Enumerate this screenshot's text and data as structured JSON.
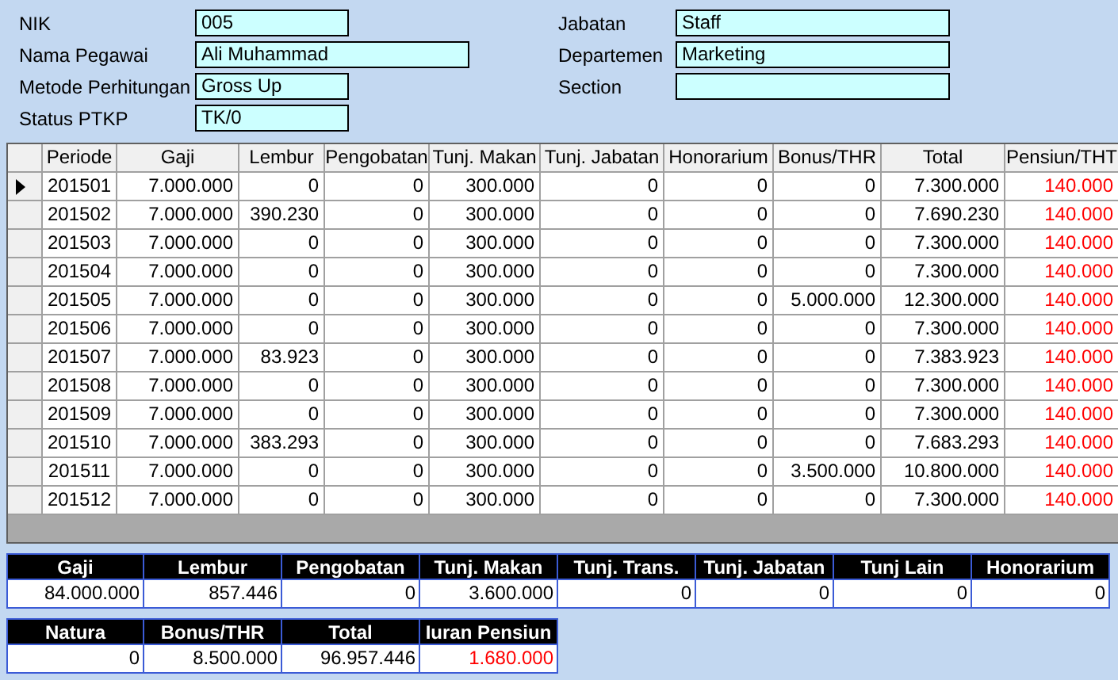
{
  "employee": {
    "left": [
      {
        "label": "NIK",
        "value": "005"
      },
      {
        "label": "Nama Pegawai",
        "value": "Ali Muhammad"
      },
      {
        "label": "Metode Perhitungan",
        "value": "Gross Up"
      },
      {
        "label": "Status PTKP",
        "value": "TK/0"
      }
    ],
    "right": [
      {
        "label": "Jabatan",
        "value": "Staff"
      },
      {
        "label": "Departemen",
        "value": "Marketing"
      },
      {
        "label": "Section"
      }
    ]
  },
  "grid": {
    "columns": [
      {
        "label": "Periode",
        "kind": "text"
      },
      {
        "label": "Gaji",
        "kind": "amount"
      },
      {
        "label": "Lembur",
        "kind": "amount"
      },
      {
        "label": "Pengobatan",
        "kind": "amount"
      },
      {
        "label": "Tunj. Makan",
        "kind": "amount"
      },
      {
        "label": "Tunj. Jabatan",
        "kind": "amount"
      },
      {
        "label": "Honorarium",
        "kind": "amount"
      },
      {
        "label": "Bonus/THR",
        "kind": "amount"
      },
      {
        "label": "Total",
        "kind": "amount"
      },
      {
        "label": "Pensiun/THT",
        "kind": "deduction"
      }
    ],
    "rows": [
      {
        "selected": true,
        "cells": [
          "201501",
          "7.000.000",
          "0",
          "0",
          "300.000",
          "0",
          "0",
          "0",
          "7.300.000",
          "140.000"
        ]
      },
      {
        "selected": false,
        "cells": [
          "201502",
          "7.000.000",
          "390.230",
          "0",
          "300.000",
          "0",
          "0",
          "0",
          "7.690.230",
          "140.000"
        ]
      },
      {
        "selected": false,
        "cells": [
          "201503",
          "7.000.000",
          "0",
          "0",
          "300.000",
          "0",
          "0",
          "0",
          "7.300.000",
          "140.000"
        ]
      },
      {
        "selected": false,
        "cells": [
          "201504",
          "7.000.000",
          "0",
          "0",
          "300.000",
          "0",
          "0",
          "0",
          "7.300.000",
          "140.000"
        ]
      },
      {
        "selected": false,
        "cells": [
          "201505",
          "7.000.000",
          "0",
          "0",
          "300.000",
          "0",
          "0",
          "5.000.000",
          "12.300.000",
          "140.000"
        ]
      },
      {
        "selected": false,
        "cells": [
          "201506",
          "7.000.000",
          "0",
          "0",
          "300.000",
          "0",
          "0",
          "0",
          "7.300.000",
          "140.000"
        ]
      },
      {
        "selected": false,
        "cells": [
          "201507",
          "7.000.000",
          "83.923",
          "0",
          "300.000",
          "0",
          "0",
          "0",
          "7.383.923",
          "140.000"
        ]
      },
      {
        "selected": false,
        "cells": [
          "201508",
          "7.000.000",
          "0",
          "0",
          "300.000",
          "0",
          "0",
          "0",
          "7.300.000",
          "140.000"
        ]
      },
      {
        "selected": false,
        "cells": [
          "201509",
          "7.000.000",
          "0",
          "0",
          "300.000",
          "0",
          "0",
          "0",
          "7.300.000",
          "140.000"
        ]
      },
      {
        "selected": false,
        "cells": [
          "201510",
          "7.000.000",
          "383.293",
          "0",
          "300.000",
          "0",
          "0",
          "0",
          "7.683.293",
          "140.000"
        ]
      },
      {
        "selected": false,
        "cells": [
          "201511",
          "7.000.000",
          "0",
          "0",
          "300.000",
          "0",
          "0",
          "3.500.000",
          "10.800.000",
          "140.000"
        ]
      },
      {
        "selected": false,
        "cells": [
          "201512",
          "7.000.000",
          "0",
          "0",
          "300.000",
          "0",
          "0",
          "0",
          "7.300.000",
          "140.000"
        ]
      }
    ]
  },
  "summary": [
    [
      {
        "label": "Gaji",
        "value": "84.000.000",
        "kind": "amount"
      },
      {
        "label": "Lembur",
        "value": "857.446",
        "kind": "amount"
      },
      {
        "label": "Pengobatan",
        "value": "0",
        "kind": "amount"
      },
      {
        "label": "Tunj. Makan",
        "value": "3.600.000",
        "kind": "amount"
      },
      {
        "label": "Tunj. Trans.",
        "value": "0",
        "kind": "amount"
      },
      {
        "label": "Tunj. Jabatan",
        "value": "0",
        "kind": "amount"
      },
      {
        "label": "Tunj Lain",
        "value": "0",
        "kind": "amount"
      },
      {
        "label": "Honorarium",
        "value": "0",
        "kind": "amount"
      }
    ],
    [
      {
        "label": "Natura",
        "value": "0",
        "kind": "amount"
      },
      {
        "label": "Bonus/THR",
        "value": "8.500.000",
        "kind": "amount"
      },
      {
        "label": "Total",
        "value": "96.957.446",
        "kind": "amount"
      },
      {
        "label": "Iuran Pensiun",
        "value": "1.680.000",
        "kind": "deduction"
      }
    ]
  ]
}
